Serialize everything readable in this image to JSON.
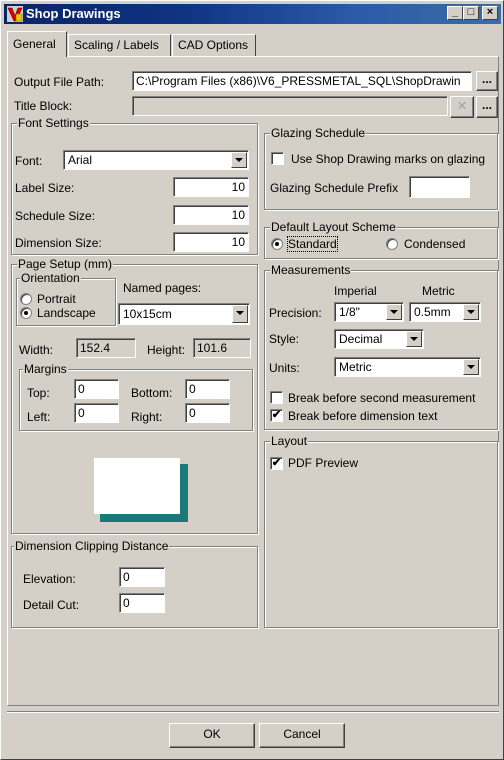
{
  "window": {
    "title": "Shop Drawings",
    "caption_buttons": [
      "_",
      "□",
      "×"
    ]
  },
  "tabs": [
    {
      "label": "General"
    },
    {
      "label": "Scaling / Labels"
    },
    {
      "label": "CAD Options"
    }
  ],
  "general": {
    "output_path_label": "Output File Path:",
    "output_path_value": "C:\\Program Files (x86)\\V6_PRESSMETAL_SQL\\ShopDrawin",
    "browse_label": "...",
    "title_block_label": "Title Block:",
    "title_block_value": "",
    "clear_label": "×"
  },
  "font_settings": {
    "title": "Font Settings",
    "font_label": "Font:",
    "font_value": "Arial",
    "label_size_label": "Label Size:",
    "label_size": "10",
    "schedule_size_label": "Schedule Size:",
    "schedule_size": "10",
    "dimension_size_label": "Dimension Size:",
    "dimension_size": "10"
  },
  "glazing": {
    "title": "Glazing Schedule",
    "use_marks_label": "Use Shop Drawing marks on glazing",
    "use_marks_checked": false,
    "prefix_label": "Glazing Schedule Prefix",
    "prefix_value": ""
  },
  "layout_scheme": {
    "title": "Default Layout Scheme",
    "standard_label": "Standard",
    "condensed_label": "Condensed",
    "selected": "Standard"
  },
  "page_setup": {
    "title": "Page Setup (mm)",
    "orientation_title": "Orientation",
    "portrait_label": "Portrait",
    "landscape_label": "Landscape",
    "orientation_selected": "Landscape",
    "named_pages_label": "Named pages:",
    "named_pages_value": "10x15cm",
    "width_label": "Width:",
    "width_value": "152.4",
    "height_label": "Height:",
    "height_value": "101.6",
    "margins_title": "Margins",
    "top_label": "Top:",
    "top_value": "0",
    "bottom_label": "Bottom:",
    "bottom_value": "0",
    "left_label": "Left:",
    "left_value": "0",
    "right_label": "Right:",
    "right_value": "0"
  },
  "measurements": {
    "title": "Measurements",
    "imperial_label": "Imperial",
    "metric_label": "Metric",
    "precision_label": "Precision:",
    "precision_imperial": "1/8\"",
    "precision_metric": "0.5mm",
    "style_label": "Style:",
    "style_value": "Decimal",
    "units_label": "Units:",
    "units_value": "Metric",
    "break_second_label": "Break before second measurement",
    "break_second_checked": false,
    "break_text_label": "Break before dimension text",
    "break_text_checked": true
  },
  "layout": {
    "title": "Layout",
    "pdf_preview_label": "PDF Preview",
    "pdf_preview_checked": true
  },
  "clipping": {
    "title": "Dimension Clipping Distance",
    "elevation_label": "Elevation:",
    "elevation_value": "0",
    "detail_cut_label": "Detail Cut:",
    "detail_cut_value": "0"
  },
  "footer": {
    "ok_label": "OK",
    "cancel_label": "Cancel"
  },
  "colors": {
    "title_start": "#0a246a",
    "title_end": "#3a6ea5",
    "face": "#d4d0c8",
    "preview_shadow": "#1a7a7a"
  }
}
